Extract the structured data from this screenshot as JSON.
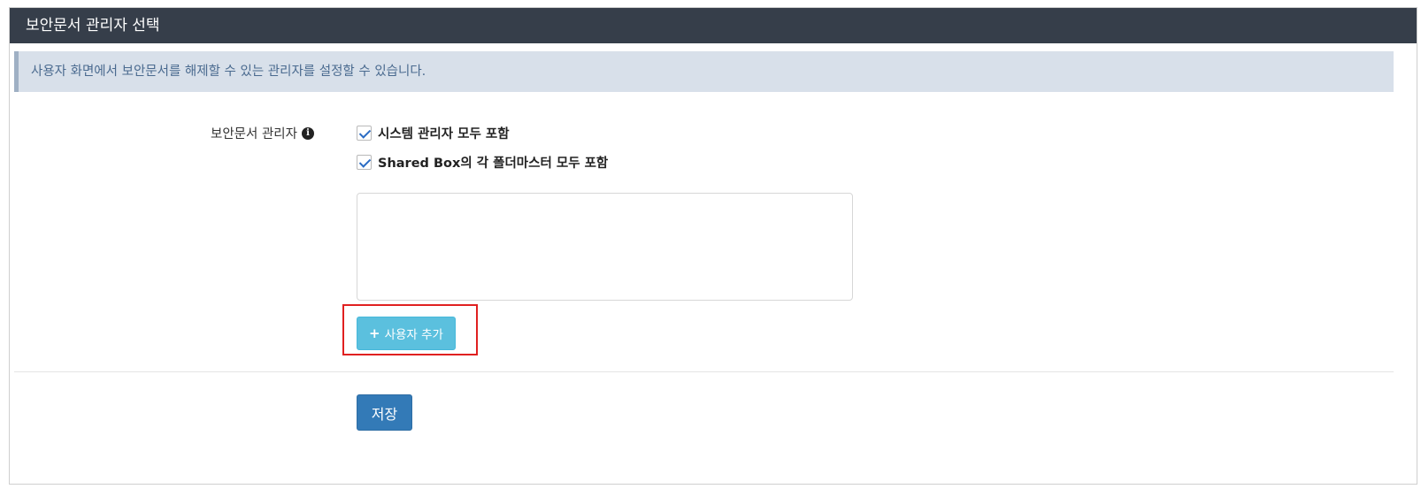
{
  "panel": {
    "title": "보안문서 관리자 선택"
  },
  "info": {
    "message": "사용자 화면에서 보안문서를 해제할 수 있는 관리자를 설정할 수 있습니다."
  },
  "form": {
    "label": "보안문서 관리자",
    "label_icon": "info-circle-icon",
    "options": [
      {
        "label": "시스템 관리자 모두 포함",
        "checked": true
      },
      {
        "label": "Shared Box의 각 폴더마스터 모두 포함",
        "checked": true
      }
    ],
    "add_user_label": "사용자 추가",
    "add_user_icon": "plus-icon"
  },
  "actions": {
    "save_label": "저장"
  },
  "colors": {
    "header_bg": "#363e4a",
    "info_bg": "#d8e0ea",
    "info_text": "#4a6a8f",
    "add_button": "#5bc0de",
    "save_button": "#337ab7",
    "highlight": "#e02020"
  }
}
